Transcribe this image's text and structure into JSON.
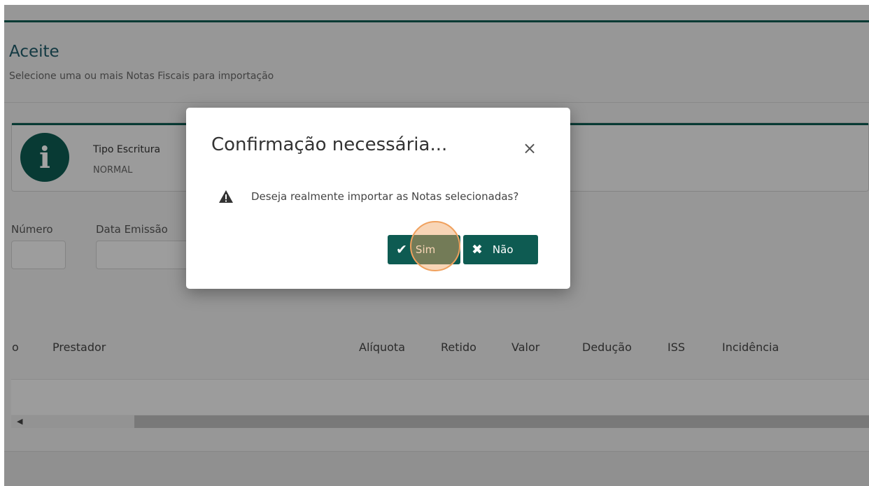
{
  "page": {
    "title": "Aceite",
    "subtitle": "Selecione uma ou mais Notas Fiscais para importação"
  },
  "info": {
    "label": "Tipo Escritura",
    "value": "NORMAL",
    "icon": "info-icon"
  },
  "filters": {
    "numero_label": "Número",
    "data_emissao_label": "Data Emissão"
  },
  "table": {
    "headers": [
      "o",
      "Prestador",
      "Alíquota",
      "Retido",
      "Valor",
      "Dedução",
      "ISS",
      "Incidência"
    ]
  },
  "modal": {
    "title": "Confirmação necessária...",
    "message": "Deseja realmente importar as Notas selecionadas?",
    "yes_label": "Sim",
    "no_label": "Não",
    "close_glyph": "×",
    "warning_icon": "warning-icon"
  },
  "colors": {
    "primary": "#0e5b52",
    "title": "#1e5a68",
    "click_highlight": "#f0a15e"
  }
}
